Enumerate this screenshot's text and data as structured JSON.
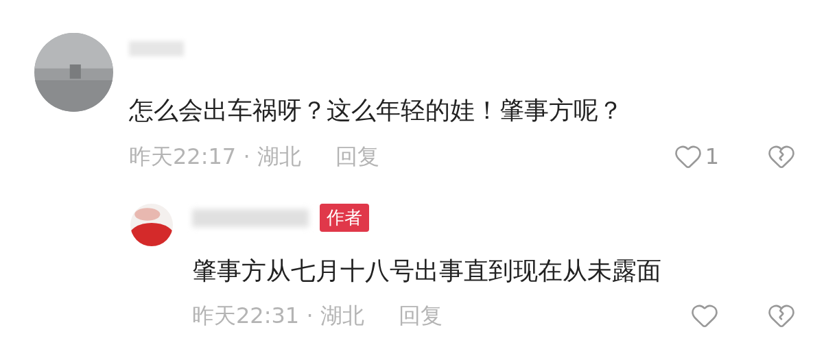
{
  "comments": [
    {
      "text": "怎么会出车祸呀？这么年轻的娃！肇事方呢？",
      "meta": "昨天22:17 · 湖北",
      "reply_label": "回复",
      "likes": "1",
      "replies": [
        {
          "badge": "作者",
          "text": "肇事方从七月十八号出事直到现在从未露面",
          "meta": "昨天22:31 · 湖北",
          "reply_label": "回复"
        }
      ]
    }
  ]
}
